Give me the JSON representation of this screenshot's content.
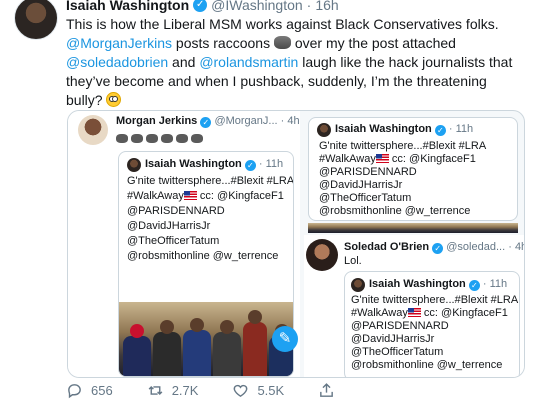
{
  "tweet": {
    "author_name": "Isaiah Washington",
    "handle": "@IWashington",
    "dot": "·",
    "time": "16h",
    "text_1": "This is how the Liberal MSM works against Black Conservatives folks. ",
    "m1": "@MorganJerkins",
    "text_2": " posts raccoons ",
    "text_3": " over my the post attached ",
    "m2": "@soledadobrien",
    "text_4": " and ",
    "m3": "@rolandsmartin",
    "text_5": " laugh like the hack journalists that they’ve become and when I pushback, suddenly, I’m the threatening bully? "
  },
  "embed": {
    "morgan": {
      "name": "Morgan Jerkins",
      "handle": "@MorganJ...",
      "dot": "·",
      "time": "4h",
      "raccoon_count": 6
    },
    "quote_left": {
      "name": "Isaiah Washington",
      "dot": "·",
      "time": "11h",
      "line1": "G'nite twittersphere...#Blexit #LRA",
      "line2_pre": "#WalkAway",
      "line2_post": " cc: @KingfaceF1",
      "line3": "@PARISDENNARD",
      "line4": "@DavidJHarrisJr",
      "line5": "@TheOfficerTatum",
      "line6": "@robsmithonline @w_terrence"
    },
    "quote_top_right": {
      "name": "Isaiah Washington",
      "dot": "·",
      "time": "11h",
      "line1": "G'nite twittersphere...#Blexit #LRA",
      "line2_pre": "#WalkAway",
      "line2_post": " cc: @KingfaceF1",
      "line3": "@PARISDENNARD",
      "line4": "@DavidJHarrisJr",
      "line5": "@TheOfficerTatum",
      "line6": "@robsmithonline @w_terrence"
    },
    "soledad": {
      "name": "Soledad O'Brien",
      "handle": "@soledad...",
      "dot": "·",
      "time": "4h",
      "text": "Lol."
    },
    "quote_bottom_right": {
      "name": "Isaiah Washington",
      "dot": "·",
      "time": "11h",
      "line1": "G'nite twittersphere...#Blexit #LRA",
      "line2_pre": "#WalkAway",
      "line2_post": " cc: @KingfaceF1",
      "line3": "@PARISDENNARD",
      "line4": "@DavidJHarrisJr",
      "line5": "@TheOfficerTatum",
      "line6": "@robsmithonline @w_terrence"
    }
  },
  "actions": {
    "replies": "656",
    "retweets": "2.7K",
    "likes": "5.5K"
  },
  "colors": {
    "link": "#1b95e0",
    "verified": "#1da1f2",
    "meta": "#657786"
  }
}
